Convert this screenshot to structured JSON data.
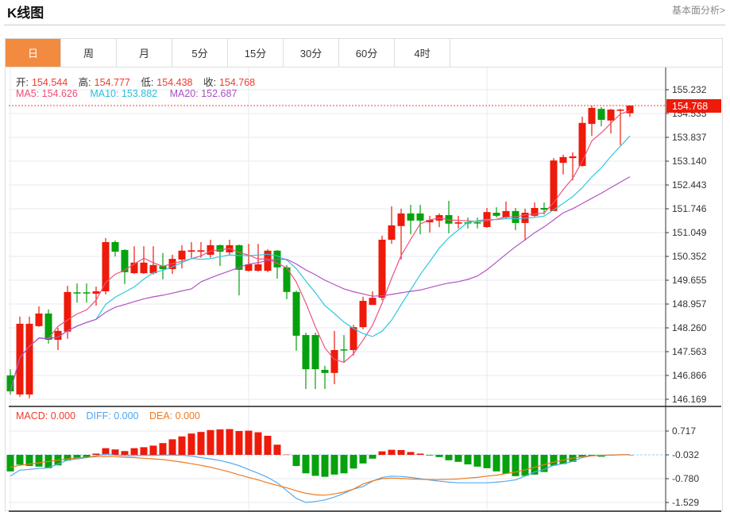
{
  "header": {
    "title": "K线图",
    "link": "基本面分析>"
  },
  "tabs": [
    {
      "label": "日",
      "active": true
    },
    {
      "label": "周"
    },
    {
      "label": "月"
    },
    {
      "label": "5分"
    },
    {
      "label": "15分"
    },
    {
      "label": "30分"
    },
    {
      "label": "60分"
    },
    {
      "label": "4时"
    }
  ],
  "ohlc_info": {
    "open_label": "开:",
    "open": "154.544",
    "high_label": "高:",
    "high": "154.777",
    "low_label": "低:",
    "low": "154.438",
    "close_label": "收:",
    "close": "154.768"
  },
  "ma_info": {
    "ma5": "MA5: 154.626",
    "ma10": "MA10: 153.882",
    "ma20": "MA20: 152.687"
  },
  "macd_info": {
    "macd": "MACD: 0.000",
    "diff": "DIFF: 0.000",
    "dea": "DEA: 0.000"
  },
  "colors": {
    "up": "#ee1a0a",
    "down": "#06a10e",
    "ma5": "#f0517e",
    "ma10": "#2ec7dc",
    "ma20": "#b352c4",
    "diff": "#55aaf0",
    "dea": "#f0791e",
    "active_tab": "#f28b3f"
  },
  "chart_data": [
    {
      "type": "candlestick",
      "current_price": "154.768",
      "ylim": [
        146.169,
        155.232
      ],
      "yticks": [
        "155.232",
        "154.535",
        "153.837",
        "153.140",
        "152.443",
        "151.746",
        "151.049",
        "150.352",
        "149.655",
        "148.957",
        "148.260",
        "147.563",
        "146.866",
        "146.169"
      ],
      "ma_periods": [
        5,
        10,
        20
      ],
      "ohlc": [
        [
          146.87,
          147.05,
          146.31,
          146.4
        ],
        [
          146.31,
          148.59,
          146.24,
          148.38
        ],
        [
          146.31,
          148.59,
          146.2,
          148.38
        ],
        [
          148.31,
          148.89,
          148.29,
          148.68
        ],
        [
          148.68,
          148.8,
          147.8,
          147.91
        ],
        [
          147.91,
          148.26,
          147.61,
          148.17
        ],
        [
          148.15,
          149.49,
          147.94,
          149.31
        ],
        [
          149.3,
          149.56,
          149.0,
          149.27
        ],
        [
          149.3,
          149.56,
          149.0,
          149.27
        ],
        [
          149.26,
          149.47,
          148.91,
          149.33
        ],
        [
          149.33,
          150.89,
          149.24,
          150.77
        ],
        [
          150.77,
          150.82,
          150.35,
          150.49
        ],
        [
          150.54,
          150.56,
          149.54,
          149.89
        ],
        [
          149.86,
          150.65,
          149.84,
          150.17
        ],
        [
          149.86,
          150.65,
          149.84,
          150.17
        ],
        [
          149.86,
          150.65,
          149.82,
          150.1
        ],
        [
          150.07,
          150.45,
          149.68,
          149.98
        ],
        [
          149.98,
          150.4,
          149.84,
          150.28
        ],
        [
          150.26,
          150.68,
          150.0,
          150.52
        ],
        [
          150.49,
          150.77,
          150.31,
          150.53
        ],
        [
          150.49,
          150.77,
          150.31,
          150.53
        ],
        [
          150.4,
          150.84,
          150.31,
          150.68
        ],
        [
          150.68,
          150.7,
          150.07,
          150.49
        ],
        [
          150.47,
          150.84,
          150.38,
          150.68
        ],
        [
          150.68,
          150.7,
          149.21,
          149.96
        ],
        [
          149.93,
          150.72,
          149.91,
          150.12
        ],
        [
          149.93,
          150.72,
          149.91,
          150.12
        ],
        [
          149.93,
          150.56,
          149.89,
          150.52
        ],
        [
          150.52,
          150.54,
          149.7,
          150.03
        ],
        [
          150.03,
          150.1,
          149.1,
          149.31
        ],
        [
          149.31,
          149.35,
          147.59,
          148.03
        ],
        [
          148.05,
          148.12,
          146.47,
          147.05
        ],
        [
          148.05,
          148.12,
          146.47,
          147.05
        ],
        [
          147.03,
          147.15,
          146.47,
          146.94
        ],
        [
          146.94,
          148.17,
          146.61,
          147.61
        ],
        [
          147.63,
          148.05,
          147.24,
          147.61
        ],
        [
          147.61,
          148.35,
          147.45,
          148.28
        ],
        [
          148.28,
          149.17,
          148.22,
          149.05
        ],
        [
          148.93,
          149.33,
          148.93,
          149.14
        ],
        [
          149.14,
          150.96,
          149.07,
          150.84
        ],
        [
          150.84,
          151.82,
          150.72,
          151.26
        ],
        [
          151.24,
          151.75,
          150.26,
          151.61
        ],
        [
          151.61,
          151.86,
          151.0,
          151.4
        ],
        [
          151.61,
          151.86,
          151.0,
          151.4
        ],
        [
          151.35,
          151.54,
          151.05,
          151.42
        ],
        [
          151.4,
          151.61,
          151.21,
          151.56
        ],
        [
          151.56,
          151.98,
          151.03,
          151.31
        ],
        [
          151.31,
          151.54,
          151.17,
          151.35
        ],
        [
          151.35,
          151.49,
          151.17,
          151.33
        ],
        [
          151.35,
          151.49,
          151.17,
          151.33
        ],
        [
          151.21,
          151.77,
          151.19,
          151.65
        ],
        [
          151.63,
          151.79,
          151.49,
          151.54
        ],
        [
          151.49,
          151.96,
          151.44,
          151.68
        ],
        [
          151.68,
          151.77,
          151.12,
          151.33
        ],
        [
          151.33,
          151.75,
          150.82,
          151.63
        ],
        [
          151.54,
          151.93,
          151.51,
          151.77
        ],
        [
          151.77,
          151.93,
          151.58,
          151.72
        ],
        [
          151.68,
          153.23,
          151.68,
          153.16
        ],
        [
          153.09,
          153.33,
          152.75,
          153.26
        ],
        [
          153.23,
          153.4,
          152.58,
          153.28
        ],
        [
          153.0,
          154.44,
          152.98,
          154.26
        ],
        [
          154.23,
          154.77,
          153.88,
          154.7
        ],
        [
          154.67,
          154.72,
          154.16,
          154.35
        ],
        [
          154.33,
          154.67,
          153.95,
          154.65
        ],
        [
          154.64,
          154.67,
          153.61,
          154.65
        ],
        [
          154.544,
          154.777,
          154.438,
          154.768
        ]
      ]
    },
    {
      "type": "macd",
      "yticks": [
        "0.717",
        "-0.032",
        "-0.780",
        "-1.529"
      ],
      "ylim": [
        -1.529,
        0.717
      ],
      "baseline": -0.032,
      "histogram": [
        -0.52,
        -0.31,
        -0.35,
        -0.37,
        -0.42,
        -0.33,
        -0.18,
        -0.12,
        -0.07,
        0.04,
        0.21,
        0.17,
        0.12,
        0.21,
        0.24,
        0.29,
        0.37,
        0.49,
        0.58,
        0.67,
        0.72,
        0.78,
        0.8,
        0.81,
        0.75,
        0.76,
        0.71,
        0.6,
        0.32,
        0.01,
        -0.35,
        -0.58,
        -0.66,
        -0.69,
        -0.62,
        -0.58,
        -0.43,
        -0.27,
        -0.12,
        0.11,
        0.16,
        0.15,
        0.09,
        0.04,
        -0.02,
        -0.07,
        -0.17,
        -0.22,
        -0.3,
        -0.37,
        -0.42,
        -0.52,
        -0.59,
        -0.67,
        -0.66,
        -0.62,
        -0.54,
        -0.34,
        -0.29,
        -0.22,
        -0.07,
        -0.03,
        -0.06,
        -0.02,
        -0.01,
        0.0
      ],
      "diff": [
        -0.7,
        -0.51,
        -0.49,
        -0.46,
        -0.44,
        -0.32,
        -0.2,
        -0.16,
        -0.12,
        -0.06,
        -0.01,
        -0.04,
        -0.06,
        -0.06,
        -0.05,
        -0.05,
        -0.04,
        -0.04,
        -0.05,
        -0.07,
        -0.12,
        -0.16,
        -0.21,
        -0.28,
        -0.37,
        -0.49,
        -0.61,
        -0.74,
        -0.91,
        -1.16,
        -1.4,
        -1.53,
        -1.5,
        -1.45,
        -1.36,
        -1.24,
        -1.11,
        -1.03,
        -0.86,
        -0.74,
        -0.7,
        -0.71,
        -0.74,
        -0.78,
        -0.82,
        -0.86,
        -0.89,
        -0.91,
        -0.91,
        -0.91,
        -0.91,
        -0.89,
        -0.86,
        -0.82,
        -0.7,
        -0.57,
        -0.49,
        -0.36,
        -0.31,
        -0.24,
        -0.12,
        -0.06,
        -0.05,
        -0.04,
        -0.03,
        -0.03
      ],
      "dea": [
        -0.42,
        -0.36,
        -0.32,
        -0.28,
        -0.24,
        -0.2,
        -0.16,
        -0.13,
        -0.11,
        -0.09,
        -0.08,
        -0.09,
        -0.11,
        -0.12,
        -0.14,
        -0.16,
        -0.18,
        -0.22,
        -0.26,
        -0.31,
        -0.36,
        -0.42,
        -0.49,
        -0.57,
        -0.66,
        -0.74,
        -0.82,
        -0.91,
        -0.99,
        -1.07,
        -1.16,
        -1.24,
        -1.29,
        -1.3,
        -1.26,
        -1.2,
        -1.11,
        -0.95,
        -0.85,
        -0.78,
        -0.76,
        -0.77,
        -0.79,
        -0.8,
        -0.81,
        -0.81,
        -0.8,
        -0.79,
        -0.76,
        -0.74,
        -0.7,
        -0.67,
        -0.62,
        -0.57,
        -0.5,
        -0.42,
        -0.34,
        -0.26,
        -0.2,
        -0.14,
        -0.09,
        -0.06,
        -0.05,
        -0.04,
        -0.03,
        -0.03
      ]
    }
  ]
}
